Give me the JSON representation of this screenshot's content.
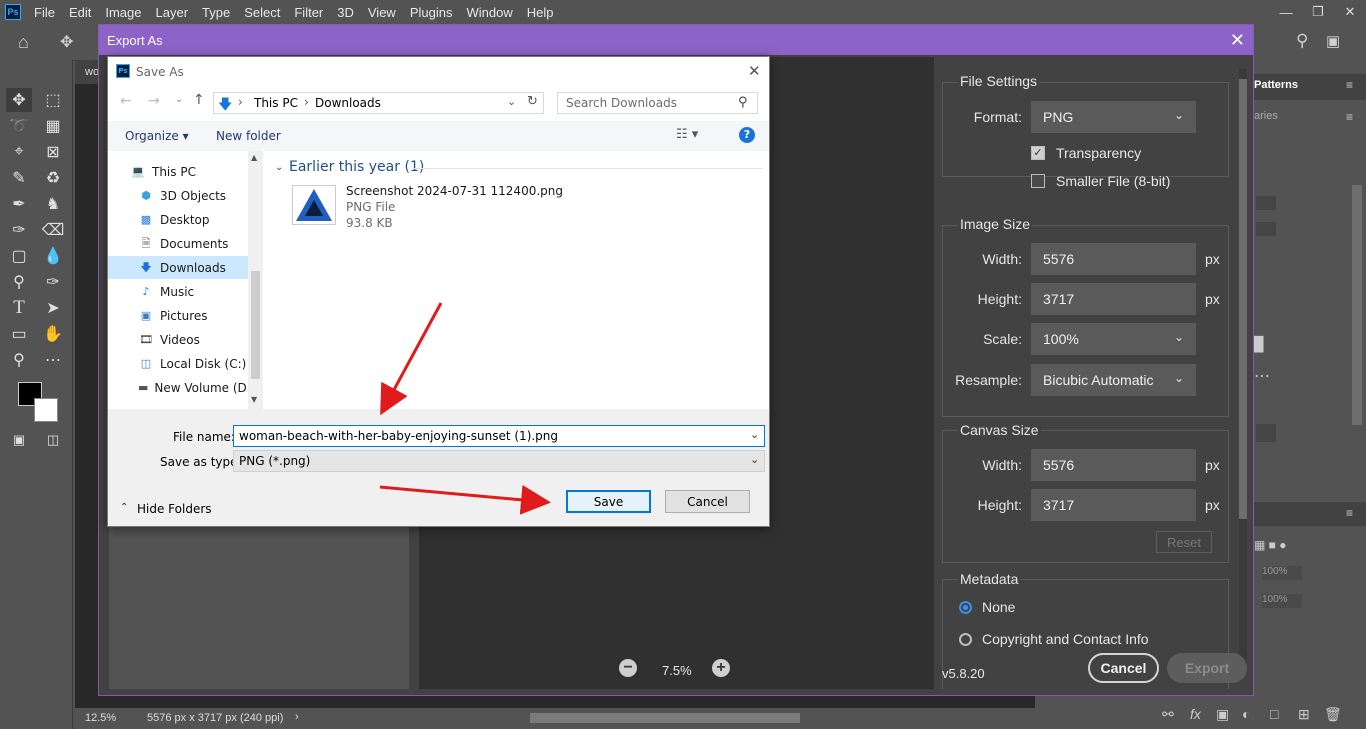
{
  "app": {
    "logo": "Ps",
    "menu": [
      "File",
      "Edit",
      "Image",
      "Layer",
      "Type",
      "Select",
      "Filter",
      "3D",
      "View",
      "Plugins",
      "Window",
      "Help"
    ],
    "doc_tab": "wo",
    "right_tab": "Patterns",
    "right_tab2": "aries",
    "status": {
      "zoom": "12.5%",
      "info": "5576 px x 3717 px (240 ppi)"
    },
    "layer_opacity": "100%",
    "layer_fill": "100%"
  },
  "export": {
    "title": "Export As",
    "file_settings": {
      "title": "File Settings",
      "format_label": "Format:",
      "format": "PNG",
      "transparency": "Transparency",
      "smaller_file": "Smaller File (8-bit)"
    },
    "image_size": {
      "title": "Image Size",
      "width_label": "Width:",
      "width": "5576",
      "height_label": "Height:",
      "height": "3717",
      "unit": "px",
      "scale_label": "Scale:",
      "scale": "100%",
      "resample_label": "Resample:",
      "resample": "Bicubic Automatic"
    },
    "canvas_size": {
      "title": "Canvas Size",
      "width_label": "Width:",
      "width": "5576",
      "height_label": "Height:",
      "height": "3717",
      "unit": "px",
      "reset": "Reset"
    },
    "metadata": {
      "title": "Metadata",
      "none": "None",
      "copyright": "Copyright and Contact Info"
    },
    "zoom": "7.5%",
    "version": "v5.8.20",
    "cancel": "Cancel",
    "export_btn": "Export"
  },
  "saveas": {
    "title": "Save As",
    "breadcrumb": [
      "This PC",
      "Downloads"
    ],
    "search_placeholder": "Search Downloads",
    "organize": "Organize",
    "new_folder": "New folder",
    "tree": [
      {
        "label": "This PC",
        "icon": "pc-icon"
      },
      {
        "label": "3D Objects",
        "icon": "cube-icon"
      },
      {
        "label": "Desktop",
        "icon": "desktop-icon"
      },
      {
        "label": "Documents",
        "icon": "document-icon"
      },
      {
        "label": "Downloads",
        "icon": "download-icon"
      },
      {
        "label": "Music",
        "icon": "music-icon"
      },
      {
        "label": "Pictures",
        "icon": "pictures-icon"
      },
      {
        "label": "Videos",
        "icon": "videos-icon"
      },
      {
        "label": "Local Disk (C:)",
        "icon": "disk-icon"
      },
      {
        "label": "New Volume (D:",
        "icon": "drive-icon"
      }
    ],
    "group": "Earlier this year (1)",
    "file": {
      "name": "Screenshot 2024-07-31 112400.png",
      "type": "PNG File",
      "size": "93.8 KB"
    },
    "filename_label": "File name:",
    "filename": "woman-beach-with-her-baby-enjoying-sunset (1).png",
    "type_label": "Save as type:",
    "type": "PNG (*.png)",
    "hide_folders": "Hide Folders",
    "save": "Save",
    "cancel": "Cancel"
  },
  "colors": {
    "export_title": "#8e63c8",
    "accent_blue": "#0078d7",
    "annotation_arrow": "#e01b1b"
  }
}
